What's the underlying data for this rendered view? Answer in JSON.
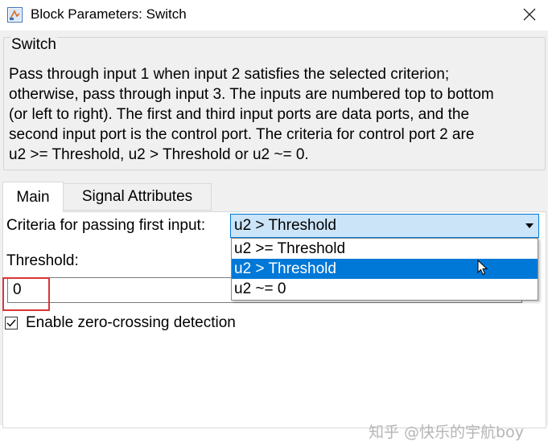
{
  "window": {
    "title": "Block Parameters: Switch",
    "icon": "simulink-block-icon"
  },
  "group": {
    "title": "Switch",
    "description": "Pass through input 1 when input 2 satisfies the selected criterion;\notherwise, pass through input 3. The inputs are numbered top to bottom\n(or left to right). The first and third input ports are data ports, and the\nsecond input port is the control port. The criteria for control port 2 are\nu2 >= Threshold, u2 > Threshold or u2 ~= 0."
  },
  "tabs": [
    {
      "label": "Main",
      "active": true
    },
    {
      "label": "Signal Attributes",
      "active": false
    }
  ],
  "criteria": {
    "label": "Criteria for passing first input:",
    "selected": "u2 > Threshold",
    "options": [
      "u2 >= Threshold",
      "u2 > Threshold",
      "u2 ~= 0"
    ]
  },
  "threshold": {
    "label": "Threshold:",
    "value": "0"
  },
  "zero_crossing": {
    "label": "Enable zero-crossing detection",
    "checked": true
  },
  "watermark": "知乎 @快乐的宇航boy",
  "colors": {
    "accent": "#0078d7",
    "selection_bg": "#cce4f7",
    "highlight": "#d93636"
  }
}
